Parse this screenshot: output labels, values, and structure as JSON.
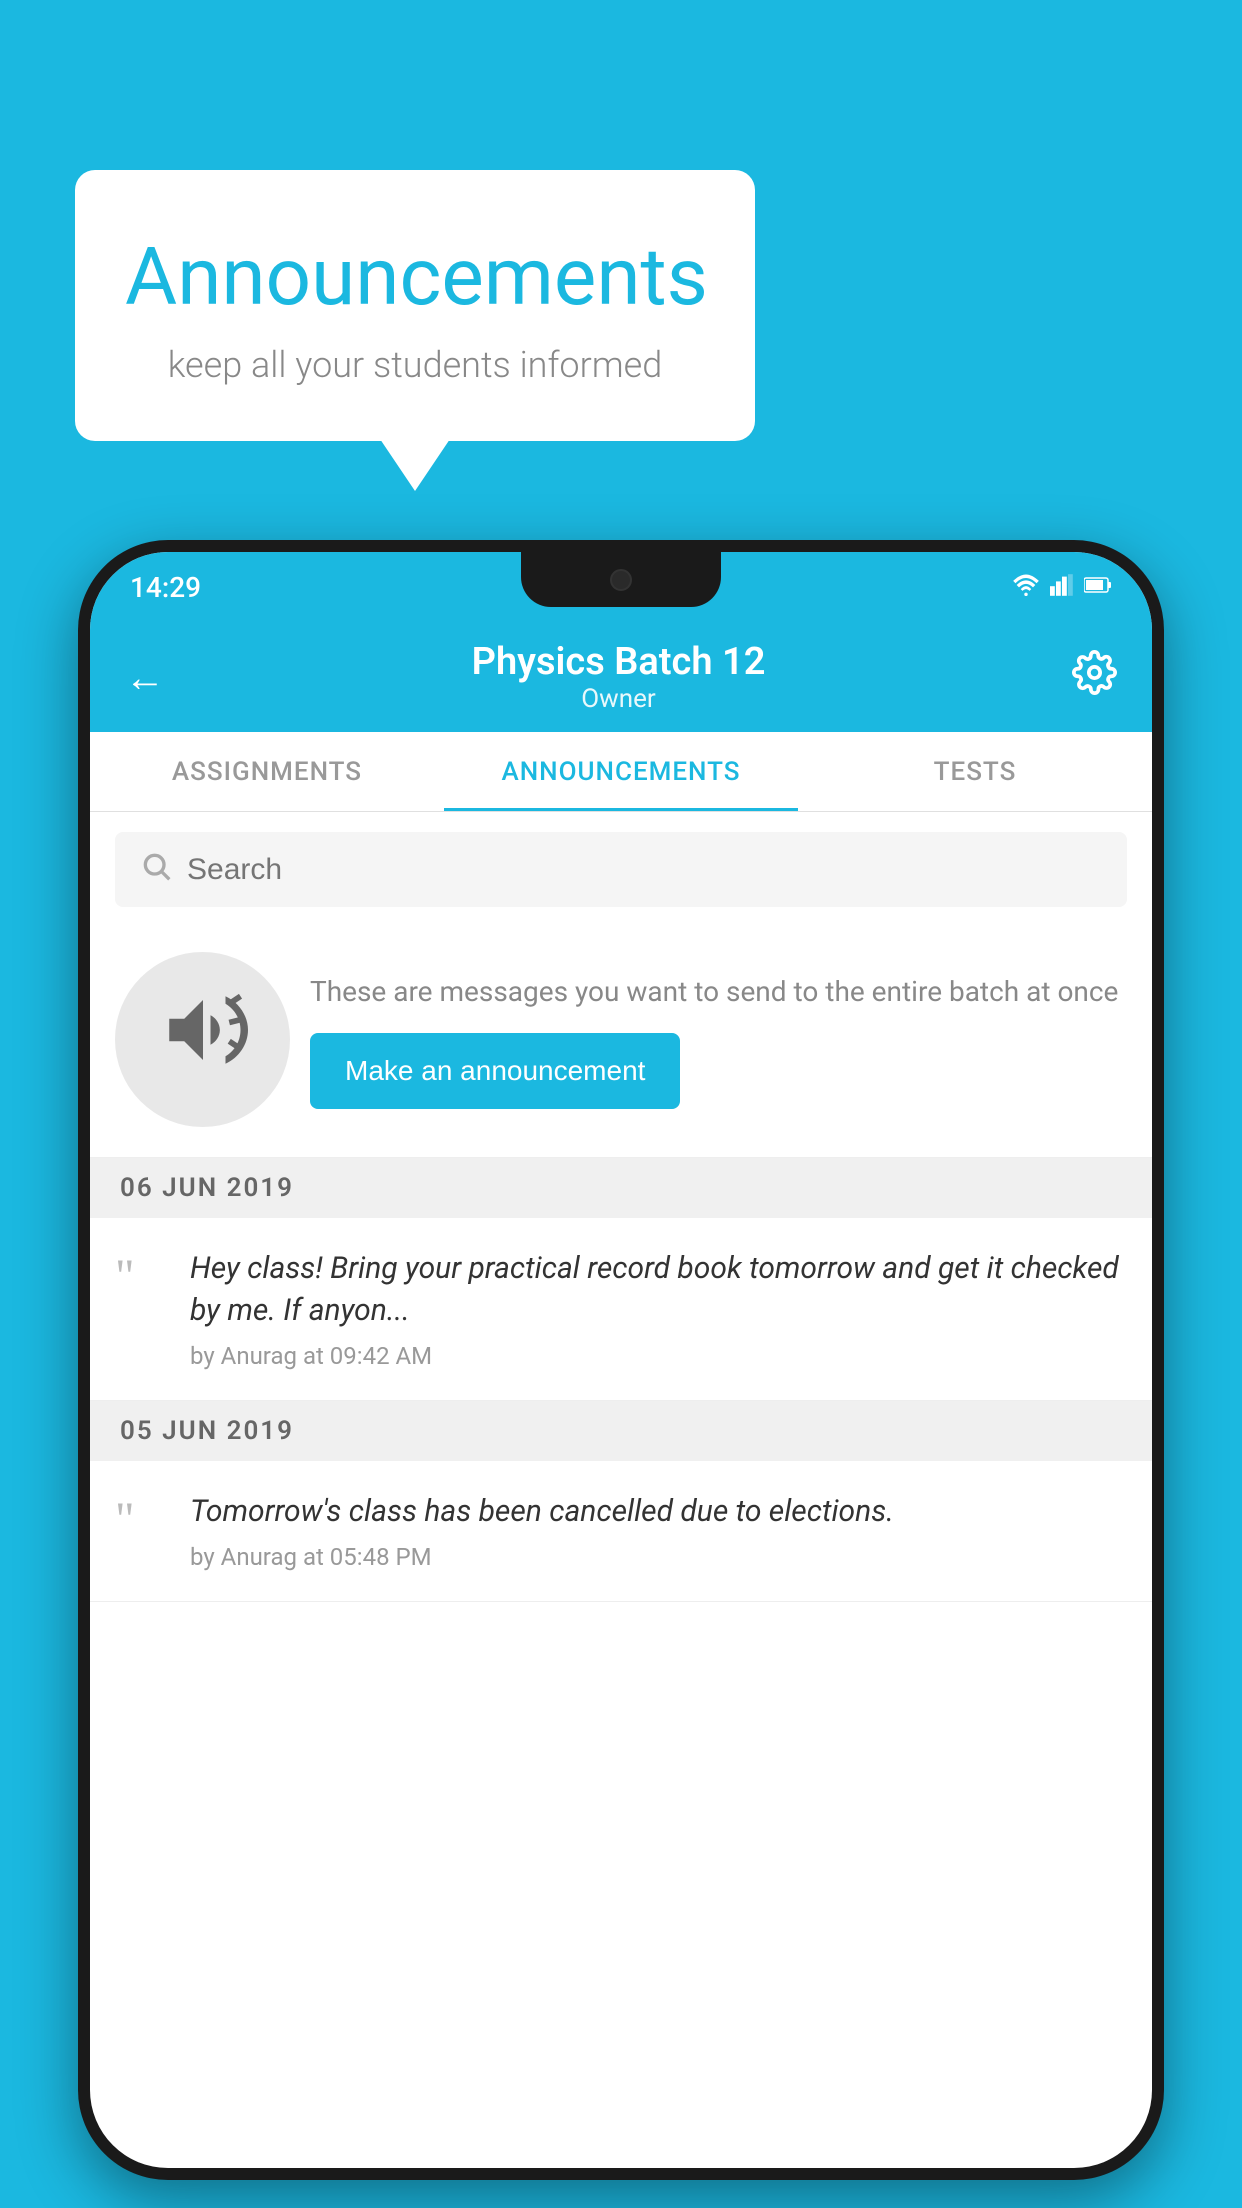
{
  "background": {
    "color": "#1BB8E0"
  },
  "speech_bubble": {
    "title": "Announcements",
    "subtitle": "keep all your students informed"
  },
  "phone": {
    "status_bar": {
      "time": "14:29",
      "wifi": "▼",
      "signal": "◀",
      "battery": "▮"
    },
    "header": {
      "back_label": "←",
      "title": "Physics Batch 12",
      "subtitle": "Owner",
      "settings_label": "⚙"
    },
    "tabs": [
      {
        "label": "ASSIGNMENTS",
        "active": false
      },
      {
        "label": "ANNOUNCEMENTS",
        "active": true
      },
      {
        "label": "TESTS",
        "active": false
      }
    ],
    "search": {
      "placeholder": "Search"
    },
    "promo": {
      "description": "These are messages you want to send to the entire batch at once",
      "button_label": "Make an announcement"
    },
    "announcements": [
      {
        "date": "06  JUN  2019",
        "text": "Hey class! Bring your practical record book tomorrow and get it checked by me. If anyon...",
        "meta": "by Anurag at 09:42 AM"
      },
      {
        "date": "05  JUN  2019",
        "text": "Tomorrow's class has been cancelled due to elections.",
        "meta": "by Anurag at 05:48 PM"
      }
    ]
  }
}
